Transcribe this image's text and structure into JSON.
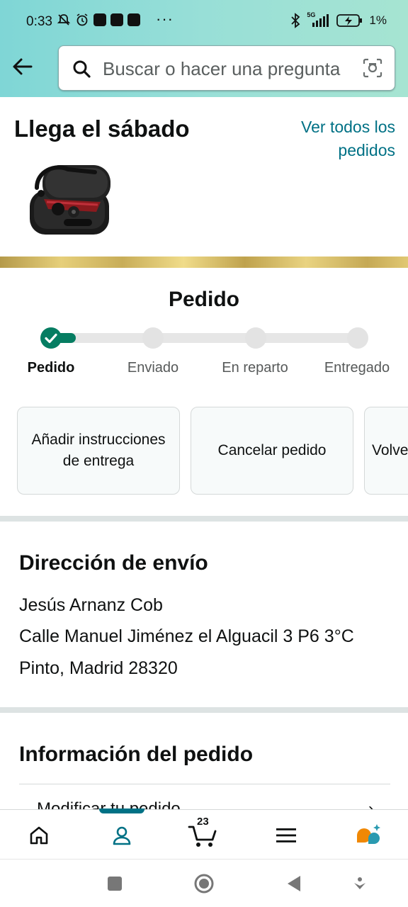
{
  "status_bar": {
    "time": "0:33",
    "dots": "···",
    "network": "5G",
    "battery_pct": "1%"
  },
  "header": {
    "search_placeholder": "Buscar o hacer una pregunta"
  },
  "arrival": {
    "title": "Llega el sábado",
    "view_all": "Ver todos los pedidos",
    "product_image": "bluetooth-earpiece-with-case"
  },
  "order_status": {
    "heading": "Pedido",
    "progress_fraction": 0.08,
    "steps": [
      {
        "label": "Pedido",
        "done": true
      },
      {
        "label": "Enviado",
        "done": false
      },
      {
        "label": "En reparto",
        "done": false
      },
      {
        "label": "Entregado",
        "done": false
      }
    ],
    "actions": [
      {
        "label": "Añadir instrucciones de entrega"
      },
      {
        "label": "Cancelar pedido"
      },
      {
        "label": "Volver a comprar"
      }
    ]
  },
  "shipping": {
    "title": "Dirección de envío",
    "name": "Jesús Arnanz Cob",
    "street": "Calle Manuel Jiménez el Alguacil 3 P6 3°C",
    "city": "Pinto, Madrid 28320"
  },
  "order_info": {
    "title": "Información del pedido",
    "row_label": "Modificar tu pedido"
  },
  "bottom_nav": {
    "items": [
      "home-icon",
      "account-icon",
      "cart-icon",
      "menu-icon",
      "rufus-icon"
    ],
    "active": "account-icon",
    "cart_count": "23"
  },
  "colors": {
    "header_gradient_start": "#7fd6d6",
    "header_gradient_end": "#a6e4d2",
    "link": "#007185",
    "progress": "#067d62",
    "accent_orange": "#f08804"
  }
}
